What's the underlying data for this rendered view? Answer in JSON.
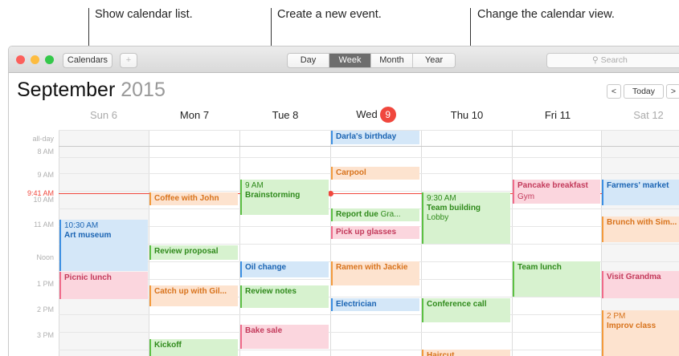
{
  "callouts": {
    "calendar_list": "Show calendar list.",
    "new_event": "Create a new event.",
    "calendar_view": "Change the calendar view."
  },
  "toolbar": {
    "calendars_label": "Calendars",
    "add_label": "+",
    "views": [
      "Day",
      "Week",
      "Month",
      "Year"
    ],
    "active_view": "Week",
    "search_placeholder": "Search",
    "search_glyph": "⚲"
  },
  "header": {
    "month": "September",
    "year": "2015",
    "prev": "<",
    "today": "Today",
    "next": ">"
  },
  "days": [
    {
      "name": "Sun 6"
    },
    {
      "name": "Mon 7"
    },
    {
      "name": "Tue 8"
    },
    {
      "name": "Wed",
      "today_num": "9"
    },
    {
      "name": "Thu 10"
    },
    {
      "name": "Fri 11"
    },
    {
      "name": "Sat 12"
    }
  ],
  "times": {
    "allday": "all-day",
    "t8": "8 AM",
    "t9": "9 AM",
    "t10": "10 AM",
    "t11": "11 AM",
    "noon": "Noon",
    "t1": "1 PM",
    "t2": "2 PM",
    "t3": "3 PM",
    "now": "9:41 AM"
  },
  "events": {
    "darla": "Darla's birthday",
    "carpool": "Carpool",
    "coffee": "Coffee with John",
    "brainstorm_time": "9 AM",
    "brainstorm": "Brainstorming",
    "pancake": "Pancake breakfast",
    "gym": "Gym",
    "farmers": "Farmers' market",
    "report_due": "Report due",
    "report_sub": "Gra...",
    "team_time": "9:30 AM",
    "team": "Team building",
    "team_loc": "Lobby",
    "art_time": "10:30 AM",
    "art": "Art museum",
    "pickup": "Pick up glasses",
    "brunch": "Brunch with Sim...",
    "review_proposal": "Review proposal",
    "oil": "Oil change",
    "ramen": "Ramen with Jackie",
    "team_lunch": "Team lunch",
    "picnic": "Picnic lunch",
    "catchup": "Catch up with Gil...",
    "review_notes": "Review notes",
    "grandma": "Visit Grandma",
    "electrician": "Electrician",
    "conf_call": "Conference call",
    "improv_time": "2 PM",
    "improv": "Improv class",
    "bake": "Bake sale",
    "kickoff": "Kickoff",
    "haircut": "Haircut"
  },
  "colors": {
    "close": "#fc605c",
    "minimize": "#fdbc40",
    "zoom": "#34c84a",
    "today_accent": "#f0473d"
  }
}
